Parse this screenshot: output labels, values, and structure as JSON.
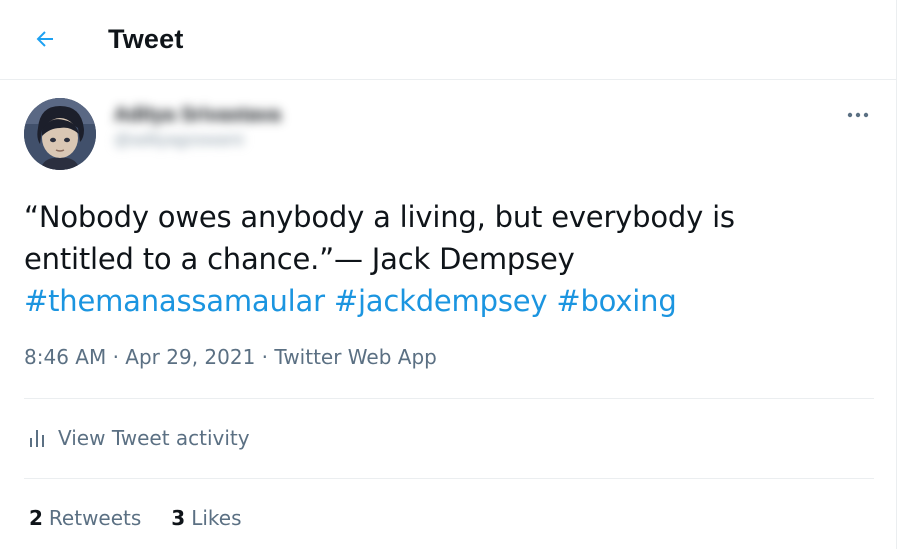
{
  "header": {
    "title": "Tweet",
    "back_icon": "arrow-left-icon",
    "accent_color": "#1da1f2"
  },
  "author": {
    "display_name": "Aditya Srivastava",
    "handle": "@adityagoswami"
  },
  "tweet": {
    "text_line1": "“Nobody owes anybody a living, but everybody is",
    "text_line2": "entitled to a chance.”— Jack Dempsey",
    "hashtags": [
      "#themanassamaular",
      "#jackdempsey",
      "#boxing"
    ],
    "hashtag_color": "#1b95e0",
    "time": "8:46 AM",
    "separator": " · ",
    "date": "Apr 29, 2021",
    "source": "Twitter Web App"
  },
  "activity": {
    "label": "View Tweet activity",
    "icon": "bar-chart-icon"
  },
  "stats": {
    "retweets_count": "2",
    "retweets_label": "Retweets",
    "likes_count": "3",
    "likes_label": "Likes"
  },
  "more_icon": "more-horizontal-icon"
}
